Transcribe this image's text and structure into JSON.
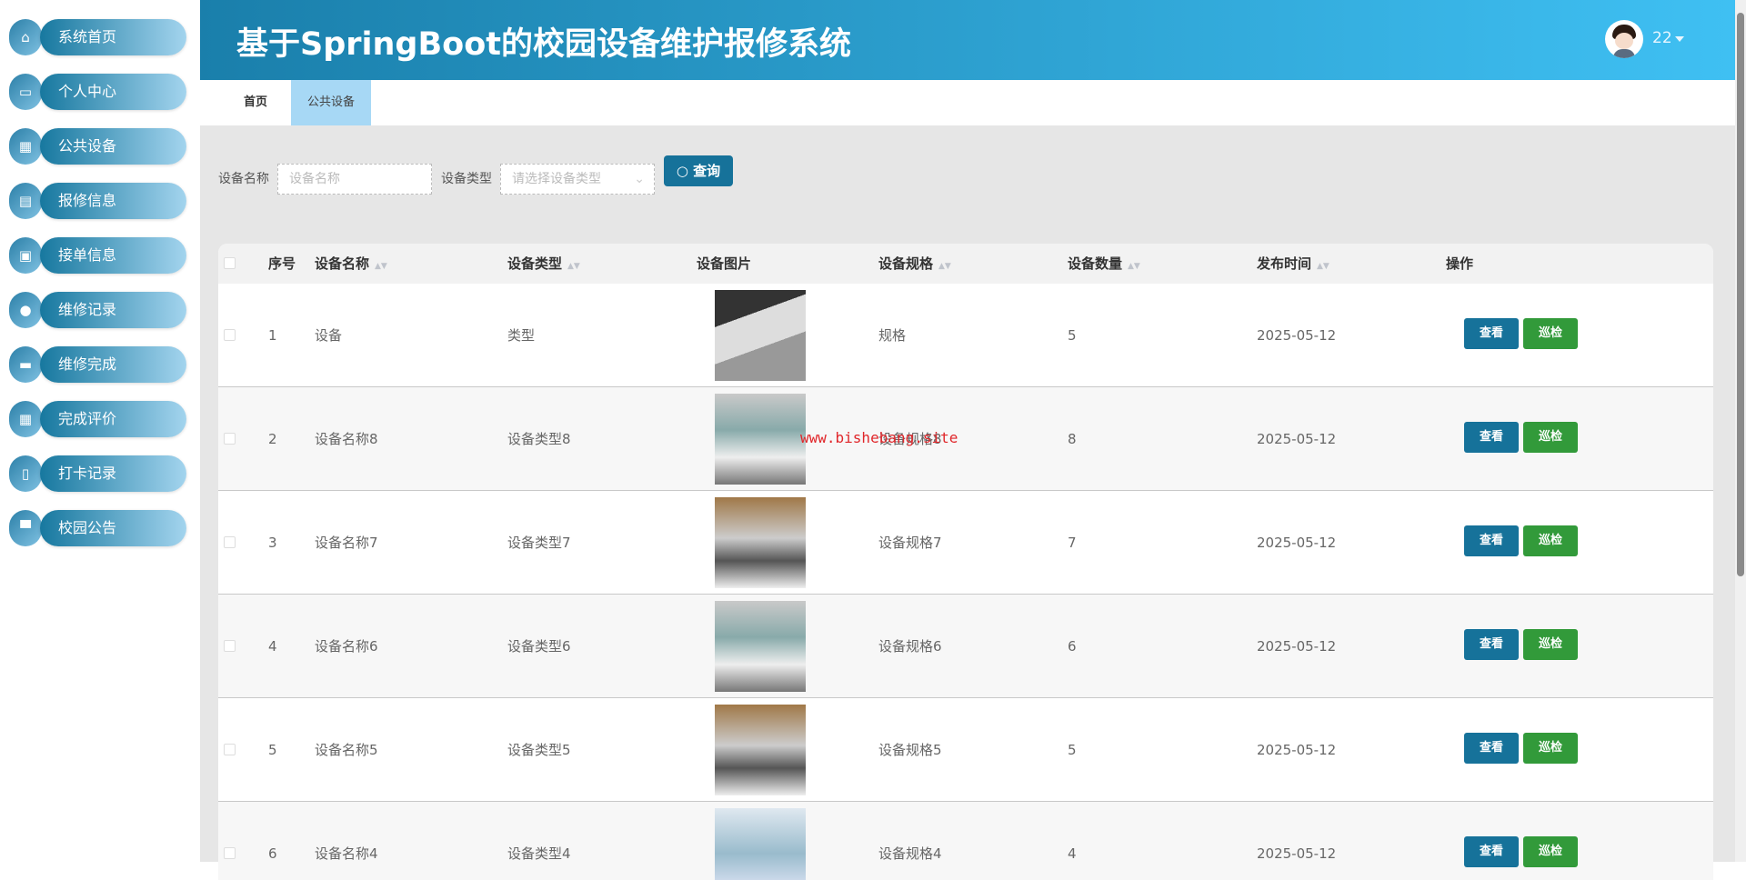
{
  "header": {
    "title": "基于SpringBoot的校园设备维护报修系统",
    "username": "22"
  },
  "sidebar": {
    "items": [
      {
        "label": "系统首页",
        "icon": "home-icon"
      },
      {
        "label": "个人中心",
        "icon": "card-icon"
      },
      {
        "label": "公共设备",
        "icon": "grid-icon"
      },
      {
        "label": "报修信息",
        "icon": "chart-icon"
      },
      {
        "label": "接单信息",
        "icon": "clipboard-icon"
      },
      {
        "label": "维修记录",
        "icon": "bulb-icon"
      },
      {
        "label": "维修完成",
        "icon": "ticket-icon"
      },
      {
        "label": "完成评价",
        "icon": "grid-icon"
      },
      {
        "label": "打卡记录",
        "icon": "document-icon"
      },
      {
        "label": "校园公告",
        "icon": "monitor-icon"
      }
    ]
  },
  "tabs": {
    "home": "首页",
    "active": "公共设备"
  },
  "search": {
    "name_label": "设备名称",
    "name_placeholder": "设备名称",
    "type_label": "设备类型",
    "type_placeholder": "请选择设备类型",
    "query_label": "查询"
  },
  "table": {
    "headers": {
      "index": "序号",
      "name": "设备名称",
      "type": "设备类型",
      "image": "设备图片",
      "spec": "设备规格",
      "count": "设备数量",
      "time": "发布时间",
      "ops": "操作"
    },
    "rows": [
      {
        "index": "1",
        "name": "设备",
        "type": "类型",
        "spec": "规格",
        "count": "5",
        "time": "2025-05-12"
      },
      {
        "index": "2",
        "name": "设备名称8",
        "type": "设备类型8",
        "spec": "设备规格8",
        "count": "8",
        "time": "2025-05-12"
      },
      {
        "index": "3",
        "name": "设备名称7",
        "type": "设备类型7",
        "spec": "设备规格7",
        "count": "7",
        "time": "2025-05-12"
      },
      {
        "index": "4",
        "name": "设备名称6",
        "type": "设备类型6",
        "spec": "设备规格6",
        "count": "6",
        "time": "2025-05-12"
      },
      {
        "index": "5",
        "name": "设备名称5",
        "type": "设备类型5",
        "spec": "设备规格5",
        "count": "5",
        "time": "2025-05-12"
      },
      {
        "index": "6",
        "name": "设备名称4",
        "type": "设备类型4",
        "spec": "设备规格4",
        "count": "4",
        "time": "2025-05-12"
      }
    ],
    "view_label": "查看",
    "inspect_label": "巡检"
  },
  "watermark": "www.bishebang.site",
  "colors": {
    "primary": "#16729a",
    "success": "#329a3a",
    "active_tab": "#a7d8f5"
  }
}
